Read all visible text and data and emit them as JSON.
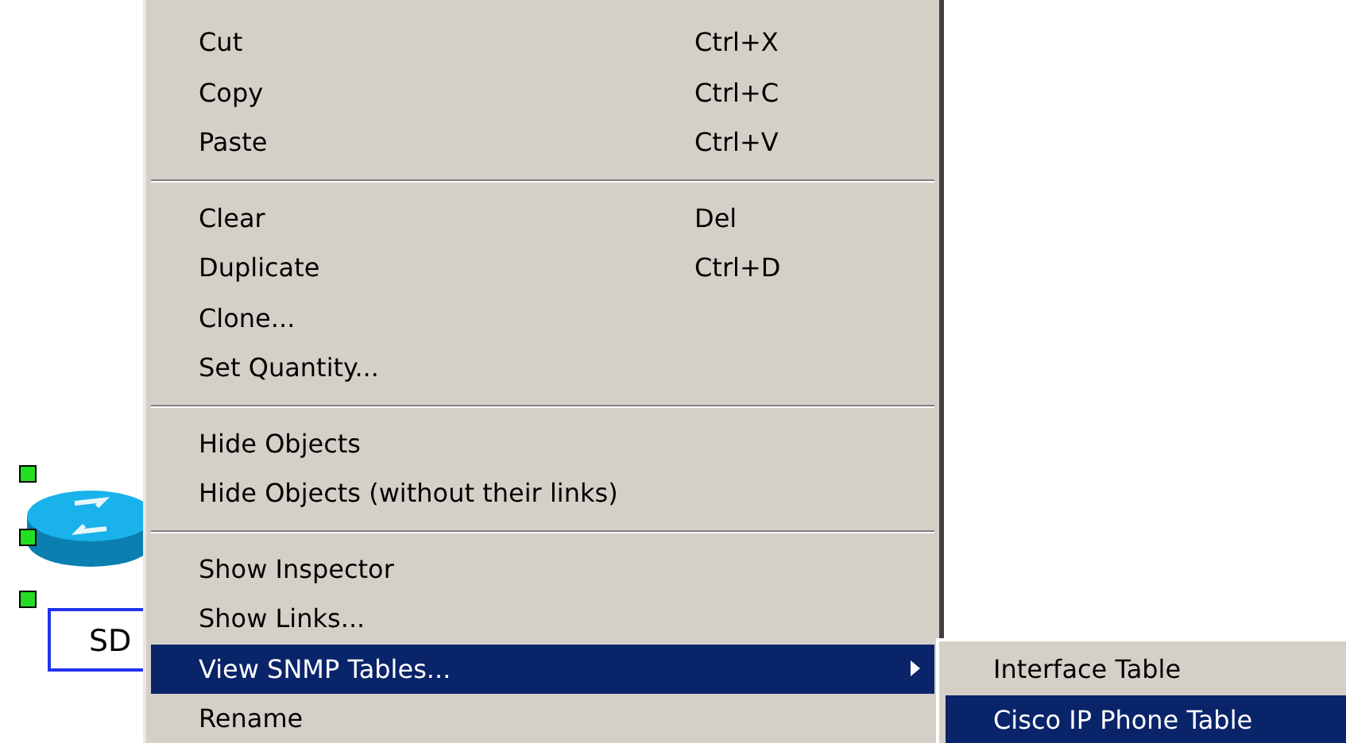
{
  "canvas": {
    "device_label": "SD"
  },
  "context_menu": {
    "items": [
      {
        "kind": "item",
        "label": "Cut",
        "shortcut": "Ctrl+X",
        "selected": false
      },
      {
        "kind": "item",
        "label": "Copy",
        "shortcut": "Ctrl+C",
        "selected": false
      },
      {
        "kind": "item",
        "label": "Paste",
        "shortcut": "Ctrl+V",
        "selected": false
      },
      {
        "kind": "separator"
      },
      {
        "kind": "item",
        "label": "Clear",
        "shortcut": "Del",
        "selected": false
      },
      {
        "kind": "item",
        "label": "Duplicate",
        "shortcut": "Ctrl+D",
        "selected": false
      },
      {
        "kind": "item",
        "label": "Clone...",
        "selected": false
      },
      {
        "kind": "item",
        "label": "Set Quantity...",
        "selected": false
      },
      {
        "kind": "separator"
      },
      {
        "kind": "item",
        "label": "Hide Objects",
        "selected": false
      },
      {
        "kind": "item",
        "label": "Hide Objects (without their links)",
        "selected": false
      },
      {
        "kind": "separator"
      },
      {
        "kind": "item",
        "label": "Show Inspector",
        "selected": false
      },
      {
        "kind": "item",
        "label": "Show Links...",
        "selected": false
      },
      {
        "kind": "submenu",
        "label": "View SNMP Tables...",
        "selected": true
      },
      {
        "kind": "item",
        "label": "Rename",
        "selected": false
      }
    ]
  },
  "submenu": {
    "items": [
      {
        "label": "Interface Table",
        "selected": false
      },
      {
        "label": "Cisco IP Phone Table",
        "selected": true
      }
    ]
  }
}
